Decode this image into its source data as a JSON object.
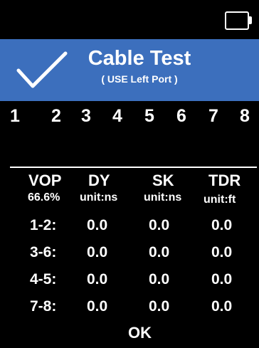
{
  "status": {
    "battery_icon": "battery-empty-icon"
  },
  "header": {
    "check_icon": "checkmark-icon",
    "title": "Cable Test",
    "subtitle": "( USE Left Port )",
    "background": "#3c6fbd"
  },
  "pins": [
    "1",
    "2",
    "3",
    "4",
    "5",
    "6",
    "7",
    "8"
  ],
  "table": {
    "columns": [
      {
        "label": "VOP",
        "unit": "66.6%"
      },
      {
        "label": "DY",
        "unit": "unit:ns"
      },
      {
        "label": "SK",
        "unit": "unit:ns"
      },
      {
        "label": "TDR",
        "unit": "unit:ft"
      }
    ],
    "rows": [
      {
        "pair": "1-2:",
        "dy": "0.0",
        "sk": "0.0",
        "tdr": "0.0"
      },
      {
        "pair": "3-6:",
        "dy": "0.0",
        "sk": "0.0",
        "tdr": "0.0"
      },
      {
        "pair": "4-5:",
        "dy": "0.0",
        "sk": "0.0",
        "tdr": "0.0"
      },
      {
        "pair": "7-8:",
        "dy": "0.0",
        "sk": "0.0",
        "tdr": "0.0"
      }
    ]
  },
  "footer": {
    "ok_label": "OK"
  }
}
